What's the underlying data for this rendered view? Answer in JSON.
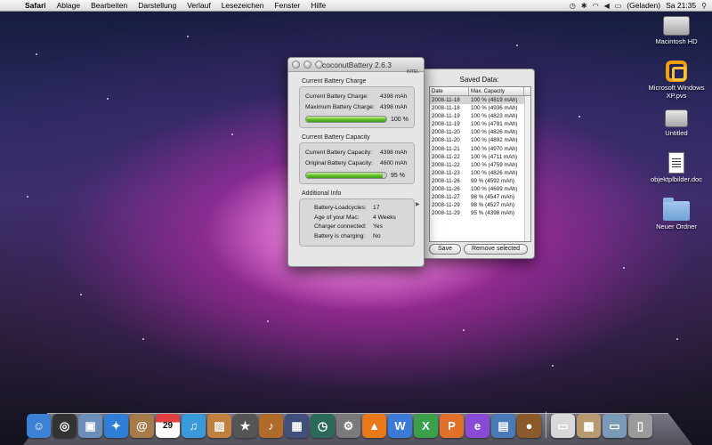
{
  "menubar": {
    "app": "Safari",
    "items": [
      "Ablage",
      "Bearbeiten",
      "Darstellung",
      "Verlauf",
      "Lesezeichen",
      "Fenster",
      "Hilfe"
    ],
    "battery_status": "(Geladen)",
    "clock": "Sa 21:35"
  },
  "desktop": {
    "icons": [
      {
        "label": "Macintosh HD",
        "icon": "hard-drive-icon"
      },
      {
        "label": "Microsoft Windows XP.pvs",
        "icon": "parallels-vm-icon"
      },
      {
        "label": "Untitled",
        "icon": "disk-icon"
      },
      {
        "label": "objektplbilder.doc",
        "icon": "document-icon"
      },
      {
        "label": "Neuer Ordner",
        "icon": "folder-icon"
      }
    ]
  },
  "app_window": {
    "title": "coconutBattery 2.6.3",
    "badge": "INTEL",
    "charge": {
      "heading": "Current Battery Charge",
      "current_label": "Current Battery Charge:",
      "current_value": "4398 mAh",
      "max_label": "Maximum Battery Charge:",
      "max_value": "4398 mAh",
      "percent_text": "100 %",
      "percent": 100
    },
    "capacity": {
      "heading": "Current Battery Capacity",
      "current_label": "Current Battery Capacity:",
      "current_value": "4398 mAh",
      "original_label": "Original Battery Capacity:",
      "original_value": "4600 mAh",
      "percent_text": "95 %",
      "percent": 95
    },
    "info": {
      "heading": "Additional Info",
      "rows": [
        {
          "label": "Battery-Loadcycles:",
          "value": "17"
        },
        {
          "label": "Age of your Mac:",
          "value": "4 Weeks"
        },
        {
          "label": "Charger connected:",
          "value": "Yes"
        },
        {
          "label": "Battery is charging:",
          "value": "No"
        }
      ]
    }
  },
  "drawer": {
    "title": "Saved Data:",
    "columns": [
      "Date",
      "Max. Capacity"
    ],
    "rows": [
      [
        "2008-11-18",
        "100 % (4819 mAh)"
      ],
      [
        "2008-11-18",
        "100 % (4936 mAh)"
      ],
      [
        "2008-11-19",
        "100 % (4823 mAh)"
      ],
      [
        "2008-11-19",
        "100 % (4791 mAh)"
      ],
      [
        "2008-11-20",
        "100 % (4826 mAh)"
      ],
      [
        "2008-11-20",
        "100 % (4892 mAh)"
      ],
      [
        "2008-11-21",
        "100 % (4970 mAh)"
      ],
      [
        "2008-11-22",
        "100 % (4711 mAh)"
      ],
      [
        "2008-11-22",
        "100 % (4759 mAh)"
      ],
      [
        "2008-11-23",
        "100 % (4826 mAh)"
      ],
      [
        "2008-11-26",
        "99 % (4592 mAh)"
      ],
      [
        "2008-11-26",
        "100 % (4609 mAh)"
      ],
      [
        "2008-11-27",
        "98 % (4547 mAh)"
      ],
      [
        "2008-11-29",
        "98 % (4527 mAh)"
      ],
      [
        "2008-11-29",
        "95 % (4398 mAh)"
      ]
    ],
    "save_label": "Save",
    "remove_label": "Remove selected"
  },
  "dock": {
    "items": [
      {
        "name": "finder-icon",
        "color": "#3b82d6",
        "glyph": "☺"
      },
      {
        "name": "dashboard-icon",
        "color": "#333333",
        "glyph": "◎"
      },
      {
        "name": "preview-icon",
        "color": "#6b8fb8",
        "glyph": "▣"
      },
      {
        "name": "safari-icon",
        "color": "#2f7fd8",
        "glyph": "✦"
      },
      {
        "name": "address-book-icon",
        "color": "#a67b4a",
        "glyph": "@"
      },
      {
        "name": "ical-icon",
        "color": "#e04040",
        "glyph": "29"
      },
      {
        "name": "itunes-icon",
        "color": "#3a9ad9",
        "glyph": "♫"
      },
      {
        "name": "iphoto-icon",
        "color": "#c08040",
        "glyph": "▨"
      },
      {
        "name": "imovie-icon",
        "color": "#555555",
        "glyph": "★"
      },
      {
        "name": "garageband-icon",
        "color": "#b06a2a",
        "glyph": "♪"
      },
      {
        "name": "spaces-icon",
        "color": "#40507a",
        "glyph": "▦"
      },
      {
        "name": "time-machine-icon",
        "color": "#2a6a5a",
        "glyph": "◷"
      },
      {
        "name": "system-preferences-icon",
        "color": "#7a7a7a",
        "glyph": "⚙"
      },
      {
        "name": "vlc-icon",
        "color": "#e8781a",
        "glyph": "▲"
      },
      {
        "name": "word-icon",
        "color": "#3a7ad8",
        "glyph": "W"
      },
      {
        "name": "excel-icon",
        "color": "#3aa04a",
        "glyph": "X"
      },
      {
        "name": "powerpoint-icon",
        "color": "#e0702a",
        "glyph": "P"
      },
      {
        "name": "entourage-icon",
        "color": "#8a4ad8",
        "glyph": "e"
      },
      {
        "name": "activity-monitor-icon",
        "color": "#4a7ab8",
        "glyph": "▤"
      },
      {
        "name": "coconutbattery-icon",
        "color": "#8a5a2a",
        "glyph": "●"
      },
      {
        "name": "sep",
        "color": "",
        "glyph": ""
      },
      {
        "name": "documents-stack-icon",
        "color": "#d8d8d8",
        "glyph": "▭"
      },
      {
        "name": "pictures-stack-icon",
        "color": "#b89a70",
        "glyph": "▩"
      },
      {
        "name": "downloads-stack-icon",
        "color": "#7a9ab8",
        "glyph": "▭"
      },
      {
        "name": "trash-icon",
        "color": "#9a9a9a",
        "glyph": "▯"
      }
    ]
  }
}
